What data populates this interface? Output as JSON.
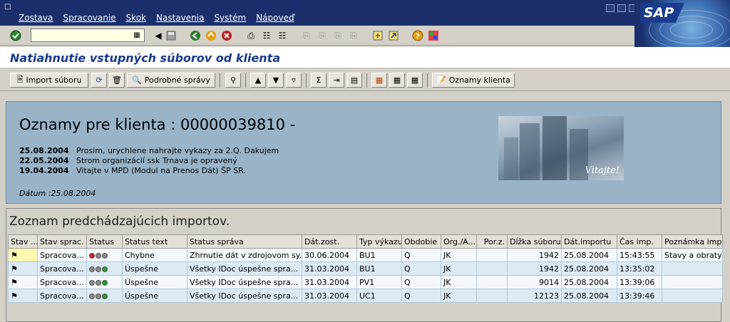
{
  "menu": {
    "items": [
      "Zostava",
      "Spracovanie",
      "Skok",
      "Nastavenia",
      "Systém",
      "Nápoveď"
    ]
  },
  "logo": "SAP",
  "title": "Natiahnutie vstupných súborov od klienta",
  "toolbar": {
    "import_label": "Import súboru",
    "details_label": "Podrobné správy",
    "notices_label": "Oznamy klienta"
  },
  "welcome": {
    "title": "Oznamy pre klienta : 00000039810 -",
    "notes": [
      {
        "date": "25.08.2004",
        "text": "Prosim, urychlene nahrajte vykazy za 2.Q. Dakujem"
      },
      {
        "date": "22.05.2004",
        "text": "Strom organizácií ssk Trnava je opravený"
      },
      {
        "date": "19.04.2004",
        "text": "Vitajte v MPD (Modul na Prenos Dát) ŠP SR."
      }
    ],
    "date_line": "Dátum :25.08.2004",
    "image_caption": "Vitajte!"
  },
  "list": {
    "title": "Zoznam predchádzajúcich importov.",
    "columns": [
      "Stav ...",
      "Stav sprac.",
      "Status",
      "Status text",
      "Status správa",
      "Dát.zost.",
      "Typ výkazu",
      "Obdobie",
      "Org./A...",
      "Por.z.",
      "Dĺžka súboru",
      "Dát.importu",
      "Čas imp.",
      "Poznámka imp"
    ],
    "rows": [
      {
        "stav": "",
        "sprac": "Spracova...",
        "lights": [
          "red",
          "gray",
          "gray"
        ],
        "status_text": "Chybne",
        "sprava": "Zhrnutie dát v zdrojovom sy...",
        "dat_zost": "30.06.2004",
        "typ": "BU1",
        "obdobie": "Q",
        "org": "JK",
        "porz": "",
        "dlzka": "1942",
        "dat_imp": "25.08.2004",
        "cas": "15:43:55",
        "poznamka": "Stavy a obraty n"
      },
      {
        "stav": "",
        "sprac": "Spracova...",
        "lights": [
          "gray",
          "gray",
          "green"
        ],
        "status_text": "Úspešne",
        "sprava": "Všetky IDoc úspešne spra...",
        "dat_zost": "31.03.2004",
        "typ": "BU1",
        "obdobie": "Q",
        "org": "JK",
        "porz": "",
        "dlzka": "1942",
        "dat_imp": "25.08.2004",
        "cas": "13:35:02",
        "poznamka": ""
      },
      {
        "stav": "",
        "sprac": "Spracova...",
        "lights": [
          "gray",
          "gray",
          "green"
        ],
        "status_text": "Úspešne",
        "sprava": "Všetky IDoc úspešne spra...",
        "dat_zost": "31.03.2004",
        "typ": "PV1",
        "obdobie": "Q",
        "org": "JK",
        "porz": "",
        "dlzka": "9014",
        "dat_imp": "25.08.2004",
        "cas": "13:39:06",
        "poznamka": ""
      },
      {
        "stav": "",
        "sprac": "Spracova...",
        "lights": [
          "gray",
          "gray",
          "green"
        ],
        "status_text": "Úspešne",
        "sprava": "Všetky IDoc úspešne spra...",
        "dat_zost": "31.03.2004",
        "typ": "UC1",
        "obdobie": "Q",
        "org": "JK",
        "porz": "",
        "dlzka": "12123",
        "dat_imp": "25.08.2004",
        "cas": "13:39:46",
        "poznamka": ""
      }
    ]
  },
  "colors": {
    "menubar": "#1a2f6c",
    "title": "#1a3a8c",
    "panel": "#99b4c8",
    "light_red": "#d02020",
    "light_green": "#20a020",
    "light_gray": "#8a8a8a"
  }
}
